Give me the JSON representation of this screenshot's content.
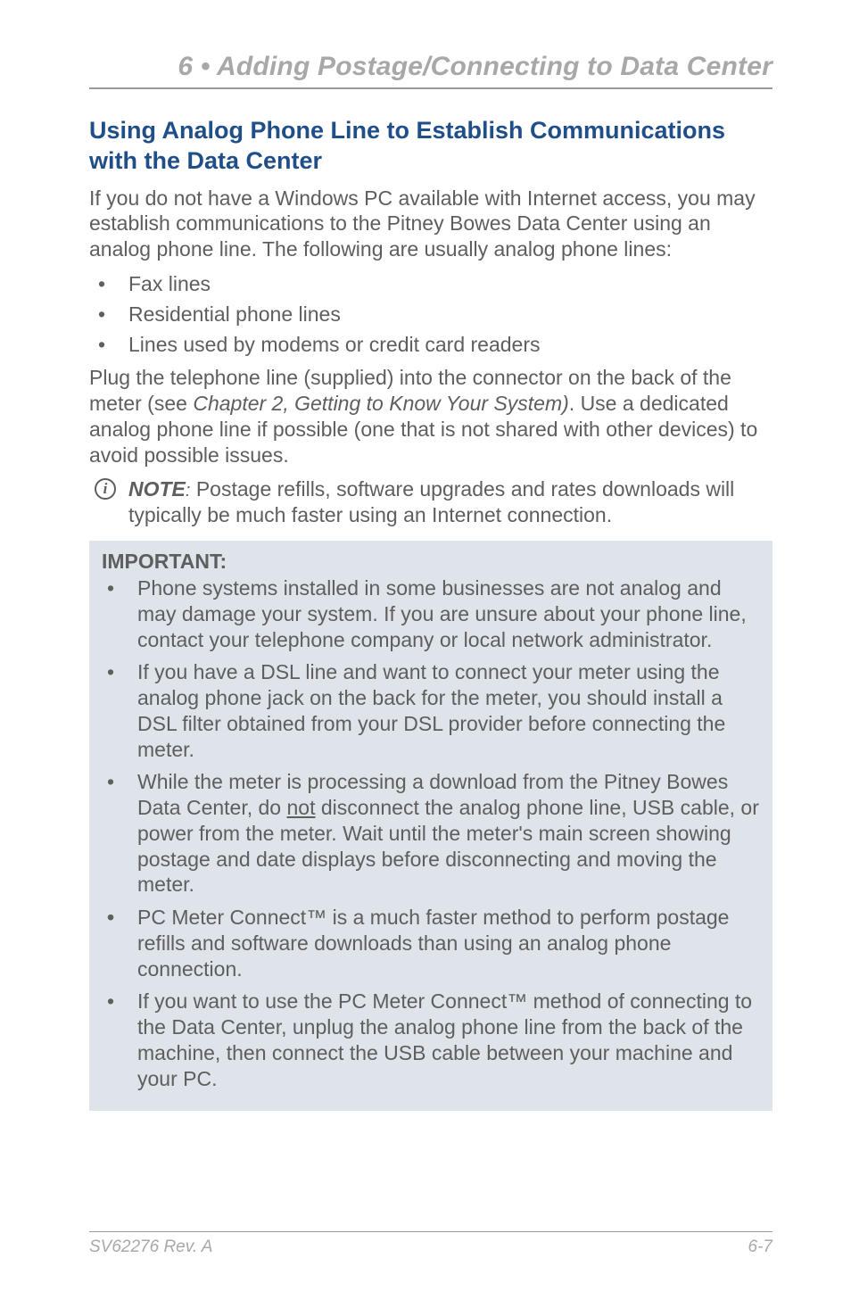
{
  "header": {
    "chapter_title": "6 • Adding Postage/Connecting to Data Center"
  },
  "section": {
    "title": "Using Analog Phone Line to Establish Communications with the Data Center",
    "intro": "If you do not have a Windows PC available with Internet access, you may establish communications to the Pitney Bowes Data Center using an analog phone line. The following are usually analog phone lines:",
    "bullets": [
      "Fax lines",
      "Residential phone lines",
      "Lines used by modems or credit card readers"
    ],
    "plug_pre": "Plug the telephone line (supplied) into the connector on the back of the meter (see ",
    "plug_ref": "Chapter 2, Getting to Know Your System)",
    "plug_post": ". Use a dedicated analog phone line if possible (one that is not shared with other devices) to avoid possible issues.",
    "note": {
      "label": "NOTE",
      "sep": ":",
      "text": " Postage refills, software upgrades and rates downloads will typically be much faster using an Internet connection."
    }
  },
  "important": {
    "heading": "IMPORTANT:",
    "items": [
      {
        "bullet": "•",
        "text": "Phone systems installed in some businesses are not analog and may damage your system. If you are unsure about your phone line, contact your telephone company or local network administrator."
      },
      {
        "bullet": "•",
        "text": "If you have a DSL line and want to connect your meter using the analog phone jack on the back for the meter, you should install a DSL filter obtained from your DSL provider before connecting the meter."
      },
      {
        "bullet": "•",
        "pre": "While the meter is processing a download from the Pitney Bowes Data Center, do ",
        "underline": "not",
        "post": " disconnect the analog phone line, USB cable, or power from the meter. Wait until the meter's main screen showing postage and date displays before disconnecting and moving the meter."
      },
      {
        "bullet": "•",
        "text": "PC Meter Connect™ is a much faster method to perform postage refills and software downloads than using an analog phone connection."
      },
      {
        "bullet": "•",
        "text": "If you want to use the PC Meter Connect™ method of connecting to the Data Center, unplug the analog phone line from the back of the machine, then connect the USB cable between your machine and your PC."
      }
    ]
  },
  "footer": {
    "left": "SV62276 Rev. A",
    "right": "6-7"
  }
}
